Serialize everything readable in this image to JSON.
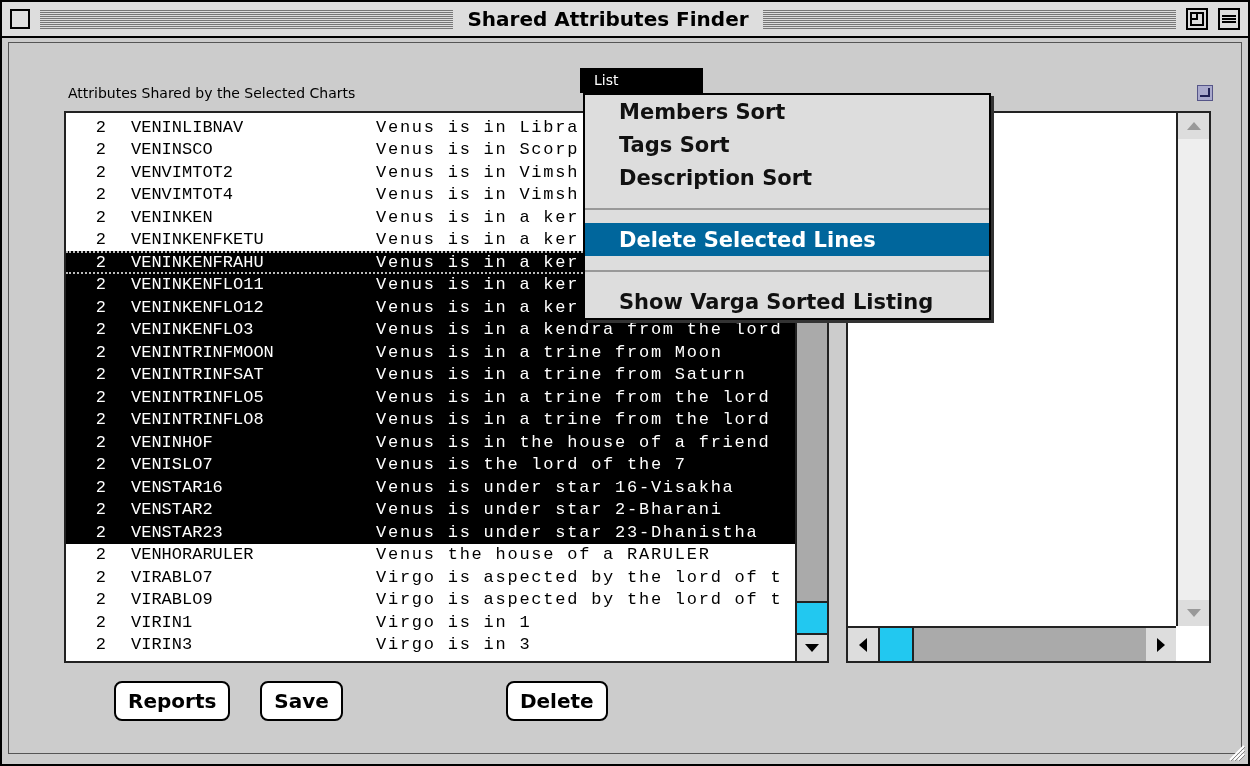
{
  "window": {
    "title": "Shared Attributes Finder"
  },
  "list_label": "Attributes Shared by the Selected Charts",
  "rows": [
    {
      "count": "2",
      "tag": "VENINLIBNAV",
      "description": "Venus is in Libra",
      "selected": false,
      "focused": false
    },
    {
      "count": "2",
      "tag": "VENINSCO",
      "description": "Venus is in Scorp",
      "selected": false,
      "focused": false
    },
    {
      "count": "2",
      "tag": "VENVIMTOT2",
      "description": "Venus is in Vimsh",
      "selected": false,
      "focused": false
    },
    {
      "count": "2",
      "tag": "VENVIMTOT4",
      "description": "Venus is in Vimsh",
      "selected": false,
      "focused": false
    },
    {
      "count": "2",
      "tag": "VENINKEN",
      "description": "Venus is in a ker",
      "selected": false,
      "focused": false
    },
    {
      "count": "2",
      "tag": "VENINKENFKETU",
      "description": "Venus is in a ker",
      "selected": false,
      "focused": false
    },
    {
      "count": "2",
      "tag": "VENINKENFRAHU",
      "description": "Venus is in a ker",
      "selected": true,
      "focused": true
    },
    {
      "count": "2",
      "tag": "VENINKENFLO11",
      "description": "Venus is in a ker",
      "selected": true,
      "focused": false
    },
    {
      "count": "2",
      "tag": "VENINKENFLO12",
      "description": "Venus is in a ker",
      "selected": true,
      "focused": false
    },
    {
      "count": "2",
      "tag": "VENINKENFLO3",
      "description": "Venus is in a kendra from the lord",
      "selected": true,
      "focused": false
    },
    {
      "count": "2",
      "tag": "VENINTRINFMOON",
      "description": "Venus is in a trine from Moon",
      "selected": true,
      "focused": false
    },
    {
      "count": "2",
      "tag": "VENINTRINFSAT",
      "description": "Venus is in a trine from Saturn",
      "selected": true,
      "focused": false
    },
    {
      "count": "2",
      "tag": "VENINTRINFLO5",
      "description": "Venus is in a trine from the lord",
      "selected": true,
      "focused": false
    },
    {
      "count": "2",
      "tag": "VENINTRINFLO8",
      "description": "Venus is in a trine from the lord",
      "selected": true,
      "focused": false
    },
    {
      "count": "2",
      "tag": "VENINHOF",
      "description": "Venus is in the house of a friend",
      "selected": true,
      "focused": false
    },
    {
      "count": "2",
      "tag": "VENISLO7",
      "description": "Venus is the lord of the 7",
      "selected": true,
      "focused": false
    },
    {
      "count": "2",
      "tag": "VENSTAR16",
      "description": "Venus is under star 16-Visakha",
      "selected": true,
      "focused": false
    },
    {
      "count": "2",
      "tag": "VENSTAR2",
      "description": "Venus is under star 2-Bharani",
      "selected": true,
      "focused": false
    },
    {
      "count": "2",
      "tag": "VENSTAR23",
      "description": "Venus is under star 23-Dhanistha",
      "selected": true,
      "focused": false
    },
    {
      "count": "2",
      "tag": "VENHORARULER",
      "description": "Venus the house of a RARULER",
      "selected": false,
      "focused": false
    },
    {
      "count": "2",
      "tag": "VIRABLO7",
      "description": "Virgo is aspected by the lord of t",
      "selected": false,
      "focused": false
    },
    {
      "count": "2",
      "tag": "VIRABLO9",
      "description": "Virgo is aspected by the lord of t",
      "selected": false,
      "focused": false
    },
    {
      "count": "2",
      "tag": "VIRIN1",
      "description": "Virgo is in 1",
      "selected": false,
      "focused": false
    },
    {
      "count": "2",
      "tag": "VIRIN3",
      "description": "Virgo is in 3",
      "selected": false,
      "focused": false
    }
  ],
  "buttons": [
    "Reports",
    "Save",
    "Delete"
  ],
  "list_menu": {
    "title": "List",
    "items": [
      {
        "kind": "item",
        "label": "Members Sort",
        "selected": false
      },
      {
        "kind": "item",
        "label": "Tags Sort",
        "selected": false
      },
      {
        "kind": "item",
        "label": "Description Sort",
        "selected": false
      },
      {
        "kind": "separator"
      },
      {
        "kind": "item",
        "label": "Delete Selected Lines",
        "selected": true
      },
      {
        "kind": "separator"
      },
      {
        "kind": "item",
        "label": "Show Varga Sorted Listing",
        "selected": false
      }
    ]
  }
}
